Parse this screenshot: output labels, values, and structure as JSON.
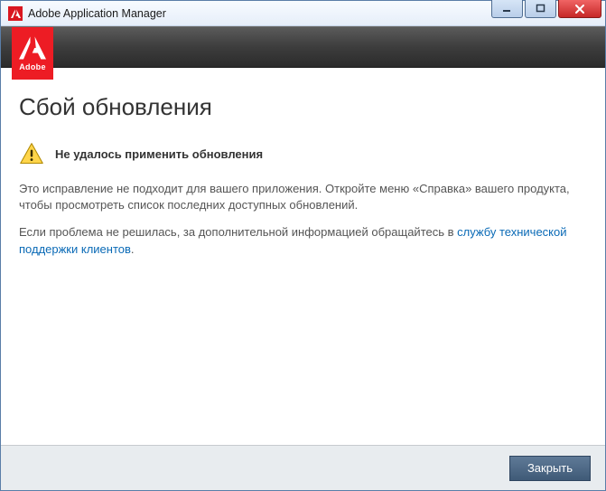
{
  "titlebar": {
    "title": "Adobe Application Manager"
  },
  "badge": {
    "label": "Adobe"
  },
  "content": {
    "heading": "Сбой обновления",
    "alert_bold": "Не удалось применить обновления",
    "para1": "Это исправление не подходит для вашего приложения. Откройте меню «Справка» вашего продукта, чтобы просмотреть список последних доступных обновлений.",
    "para2_prefix": "Если проблема не решилась, за дополнительной информацией обращайтесь в ",
    "para2_link": "службу технической поддержки клиентов",
    "para2_suffix": "."
  },
  "footer": {
    "close_label": "Закрыть"
  }
}
